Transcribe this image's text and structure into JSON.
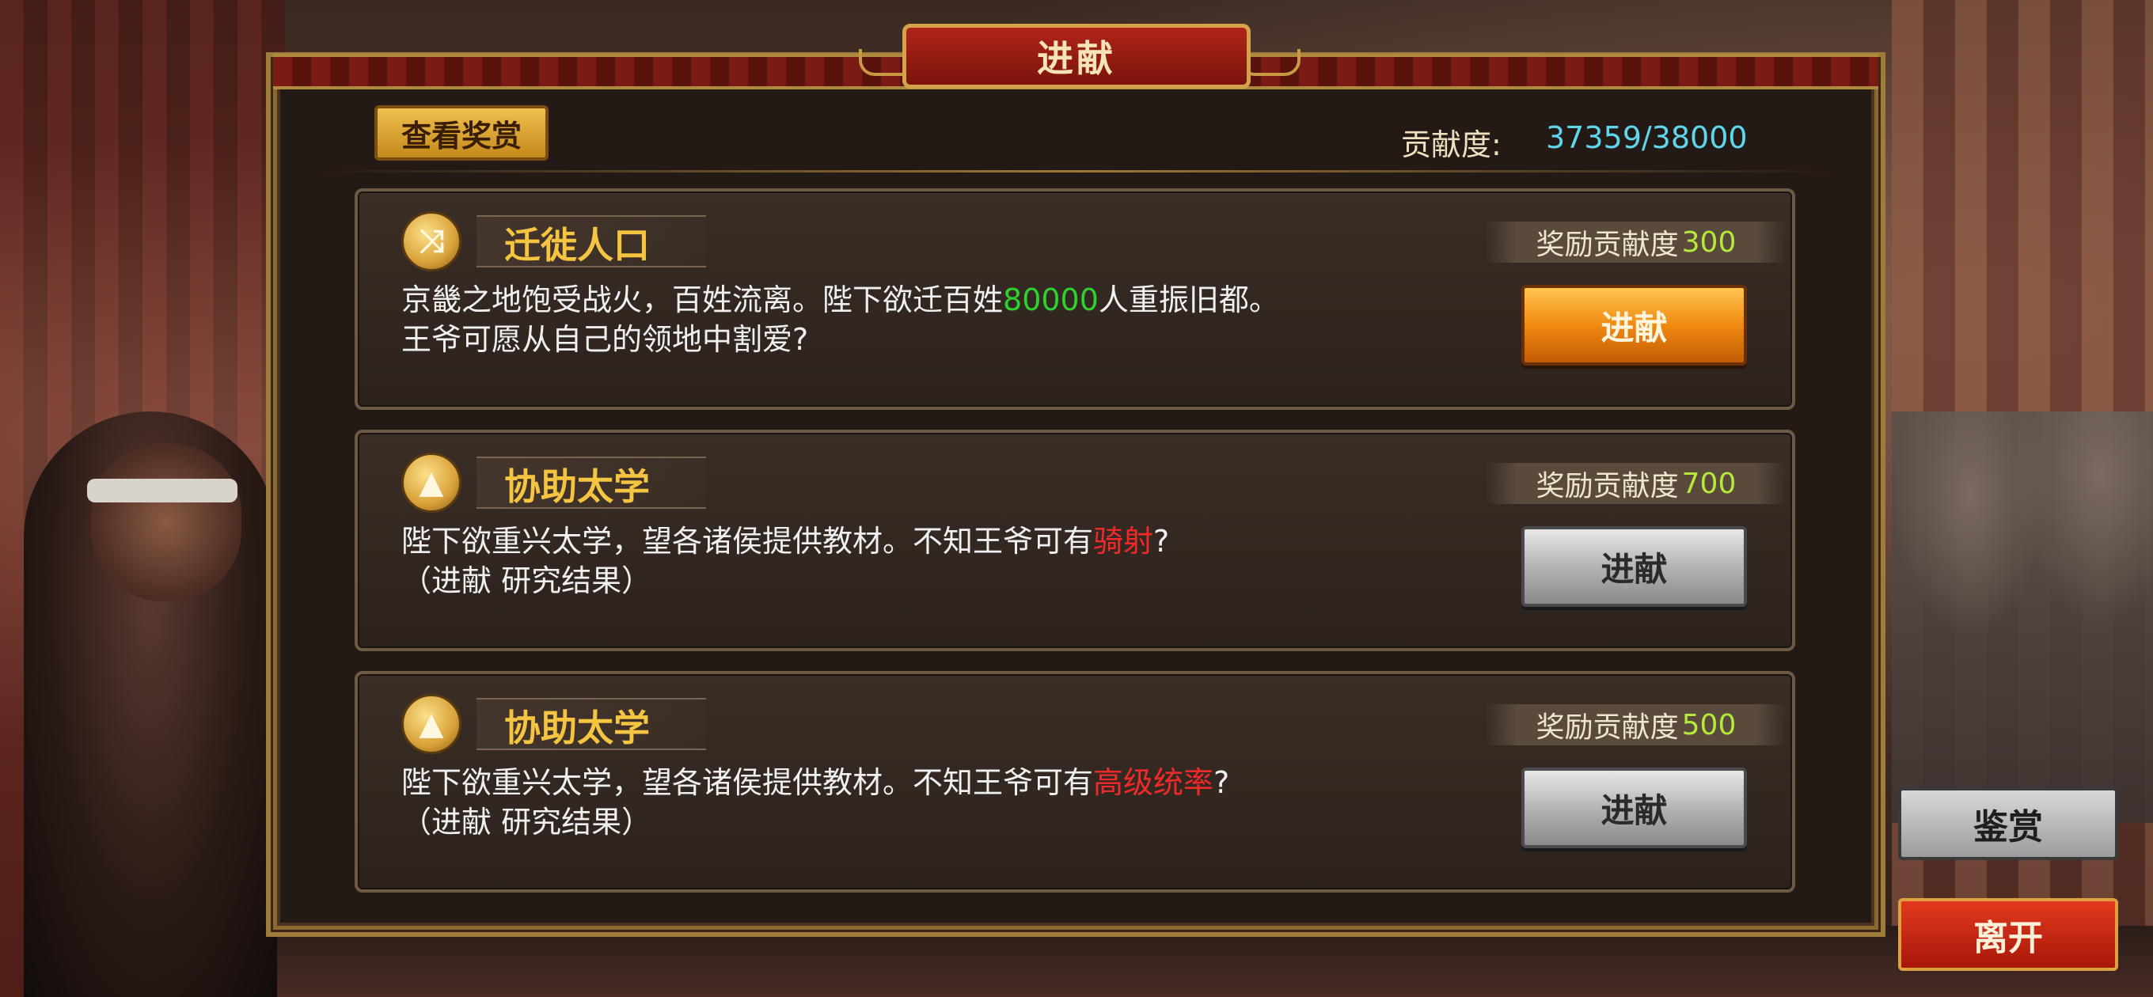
{
  "title": "进献",
  "view_reward_label": "查看奖赏",
  "contribution": {
    "label": "贡献度:",
    "value": "37359/38000"
  },
  "tasks": [
    {
      "icon": "shuffle-icon",
      "title": "迁徙人口",
      "desc_line1_before": "京畿之地饱受战火，百姓流离。陛下欲迁百姓",
      "desc_line1_highlight": "80000",
      "desc_line1_after": "人重振旧都。",
      "desc_line2": "王爷可愿从自己的领地中割爱?",
      "reward_label": "奖励贡献度",
      "reward_value": "300",
      "button_label": "进献",
      "button_state": "active"
    },
    {
      "icon": "pyramid-icon",
      "title": "协助太学",
      "desc_line1_before": "陛下欲重兴太学，望各诸侯提供教材。不知王爷可有",
      "desc_line1_highlight": "骑射",
      "desc_line1_after": "?",
      "desc_line2": "（进献 研究结果）",
      "reward_label": "奖励贡献度",
      "reward_value": "700",
      "button_label": "进献",
      "button_state": "disabled"
    },
    {
      "icon": "pyramid-icon",
      "title": "协助太学",
      "desc_line1_before": "陛下欲重兴太学，望各诸侯提供教材。不知王爷可有",
      "desc_line1_highlight": "高级统率",
      "desc_line1_after": "?",
      "desc_line2": "（进献 研究结果）",
      "reward_label": "奖励贡献度",
      "reward_value": "500",
      "button_label": "进献",
      "button_state": "disabled"
    }
  ],
  "side_buttons": {
    "appreciate": "鉴赏",
    "leave": "离开"
  },
  "colors": {
    "highlight_green": "#2ed12e",
    "highlight_red": "#f02a2a",
    "contribution_value": "#5fd6ec",
    "reward_value": "#b6ea3a",
    "title_gold": "#f5c542"
  }
}
